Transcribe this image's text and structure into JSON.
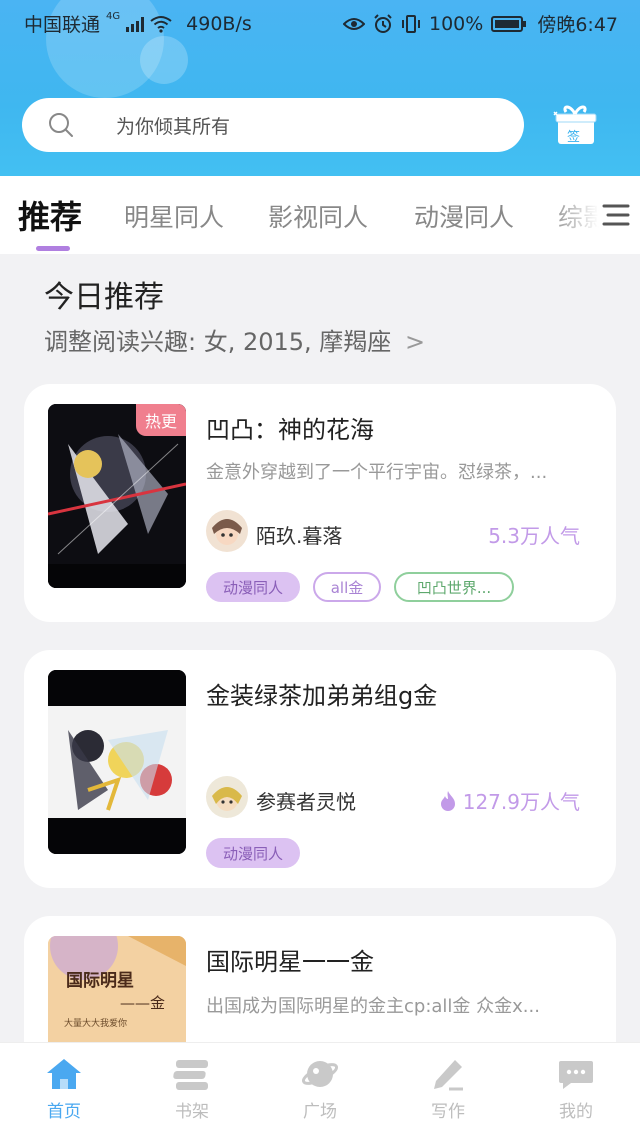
{
  "status_bar": {
    "carrier": "中国联通",
    "network": "4G",
    "speed": "490B/s",
    "battery": "100%",
    "time": "傍晚6:47"
  },
  "search": {
    "placeholder": "为你倾其所有"
  },
  "gift_label": "签",
  "tabs": [
    "推荐",
    "明星同人",
    "影视同人",
    "动漫同人",
    "综影"
  ],
  "section": {
    "title": "今日推荐",
    "subtitle": "调整阅读兴趣: 女, 2015, 摩羯座",
    "chevron": ">"
  },
  "books": [
    {
      "title": "凹凸：神的花海",
      "desc": "金意外穿越到了一个平行宇宙。怼绿茶，...",
      "author": "陌玖.暮落",
      "popularity": "5.3万人气",
      "badge": "热更",
      "tags": [
        "动漫同人",
        "all金",
        "凹凸世界..."
      ]
    },
    {
      "title": "金装绿茶加弟弟组g金",
      "desc": "",
      "author": "参赛者灵悦",
      "popularity": "127.9万人气",
      "tags": [
        "动漫同人"
      ]
    },
    {
      "title": "国际明星一一金",
      "desc": "出国成为国际明星的金主cp:all金  众金x...",
      "cover_text": "国际明星",
      "cover_sub": "——金",
      "cover_small": "大量大大我爱你"
    }
  ],
  "nav": [
    {
      "label": "首页",
      "icon": "home-icon",
      "active": true
    },
    {
      "label": "书架",
      "icon": "bookshelf-icon",
      "active": false
    },
    {
      "label": "广场",
      "icon": "planet-icon",
      "active": false
    },
    {
      "label": "写作",
      "icon": "pen-icon",
      "active": false
    },
    {
      "label": "我的",
      "icon": "chat-icon",
      "active": false
    }
  ],
  "colors": {
    "header": "#43b6f2",
    "accent_purple": "#b07fe0",
    "badge": "#f07f8e",
    "nav_active": "#4aa8f0"
  }
}
